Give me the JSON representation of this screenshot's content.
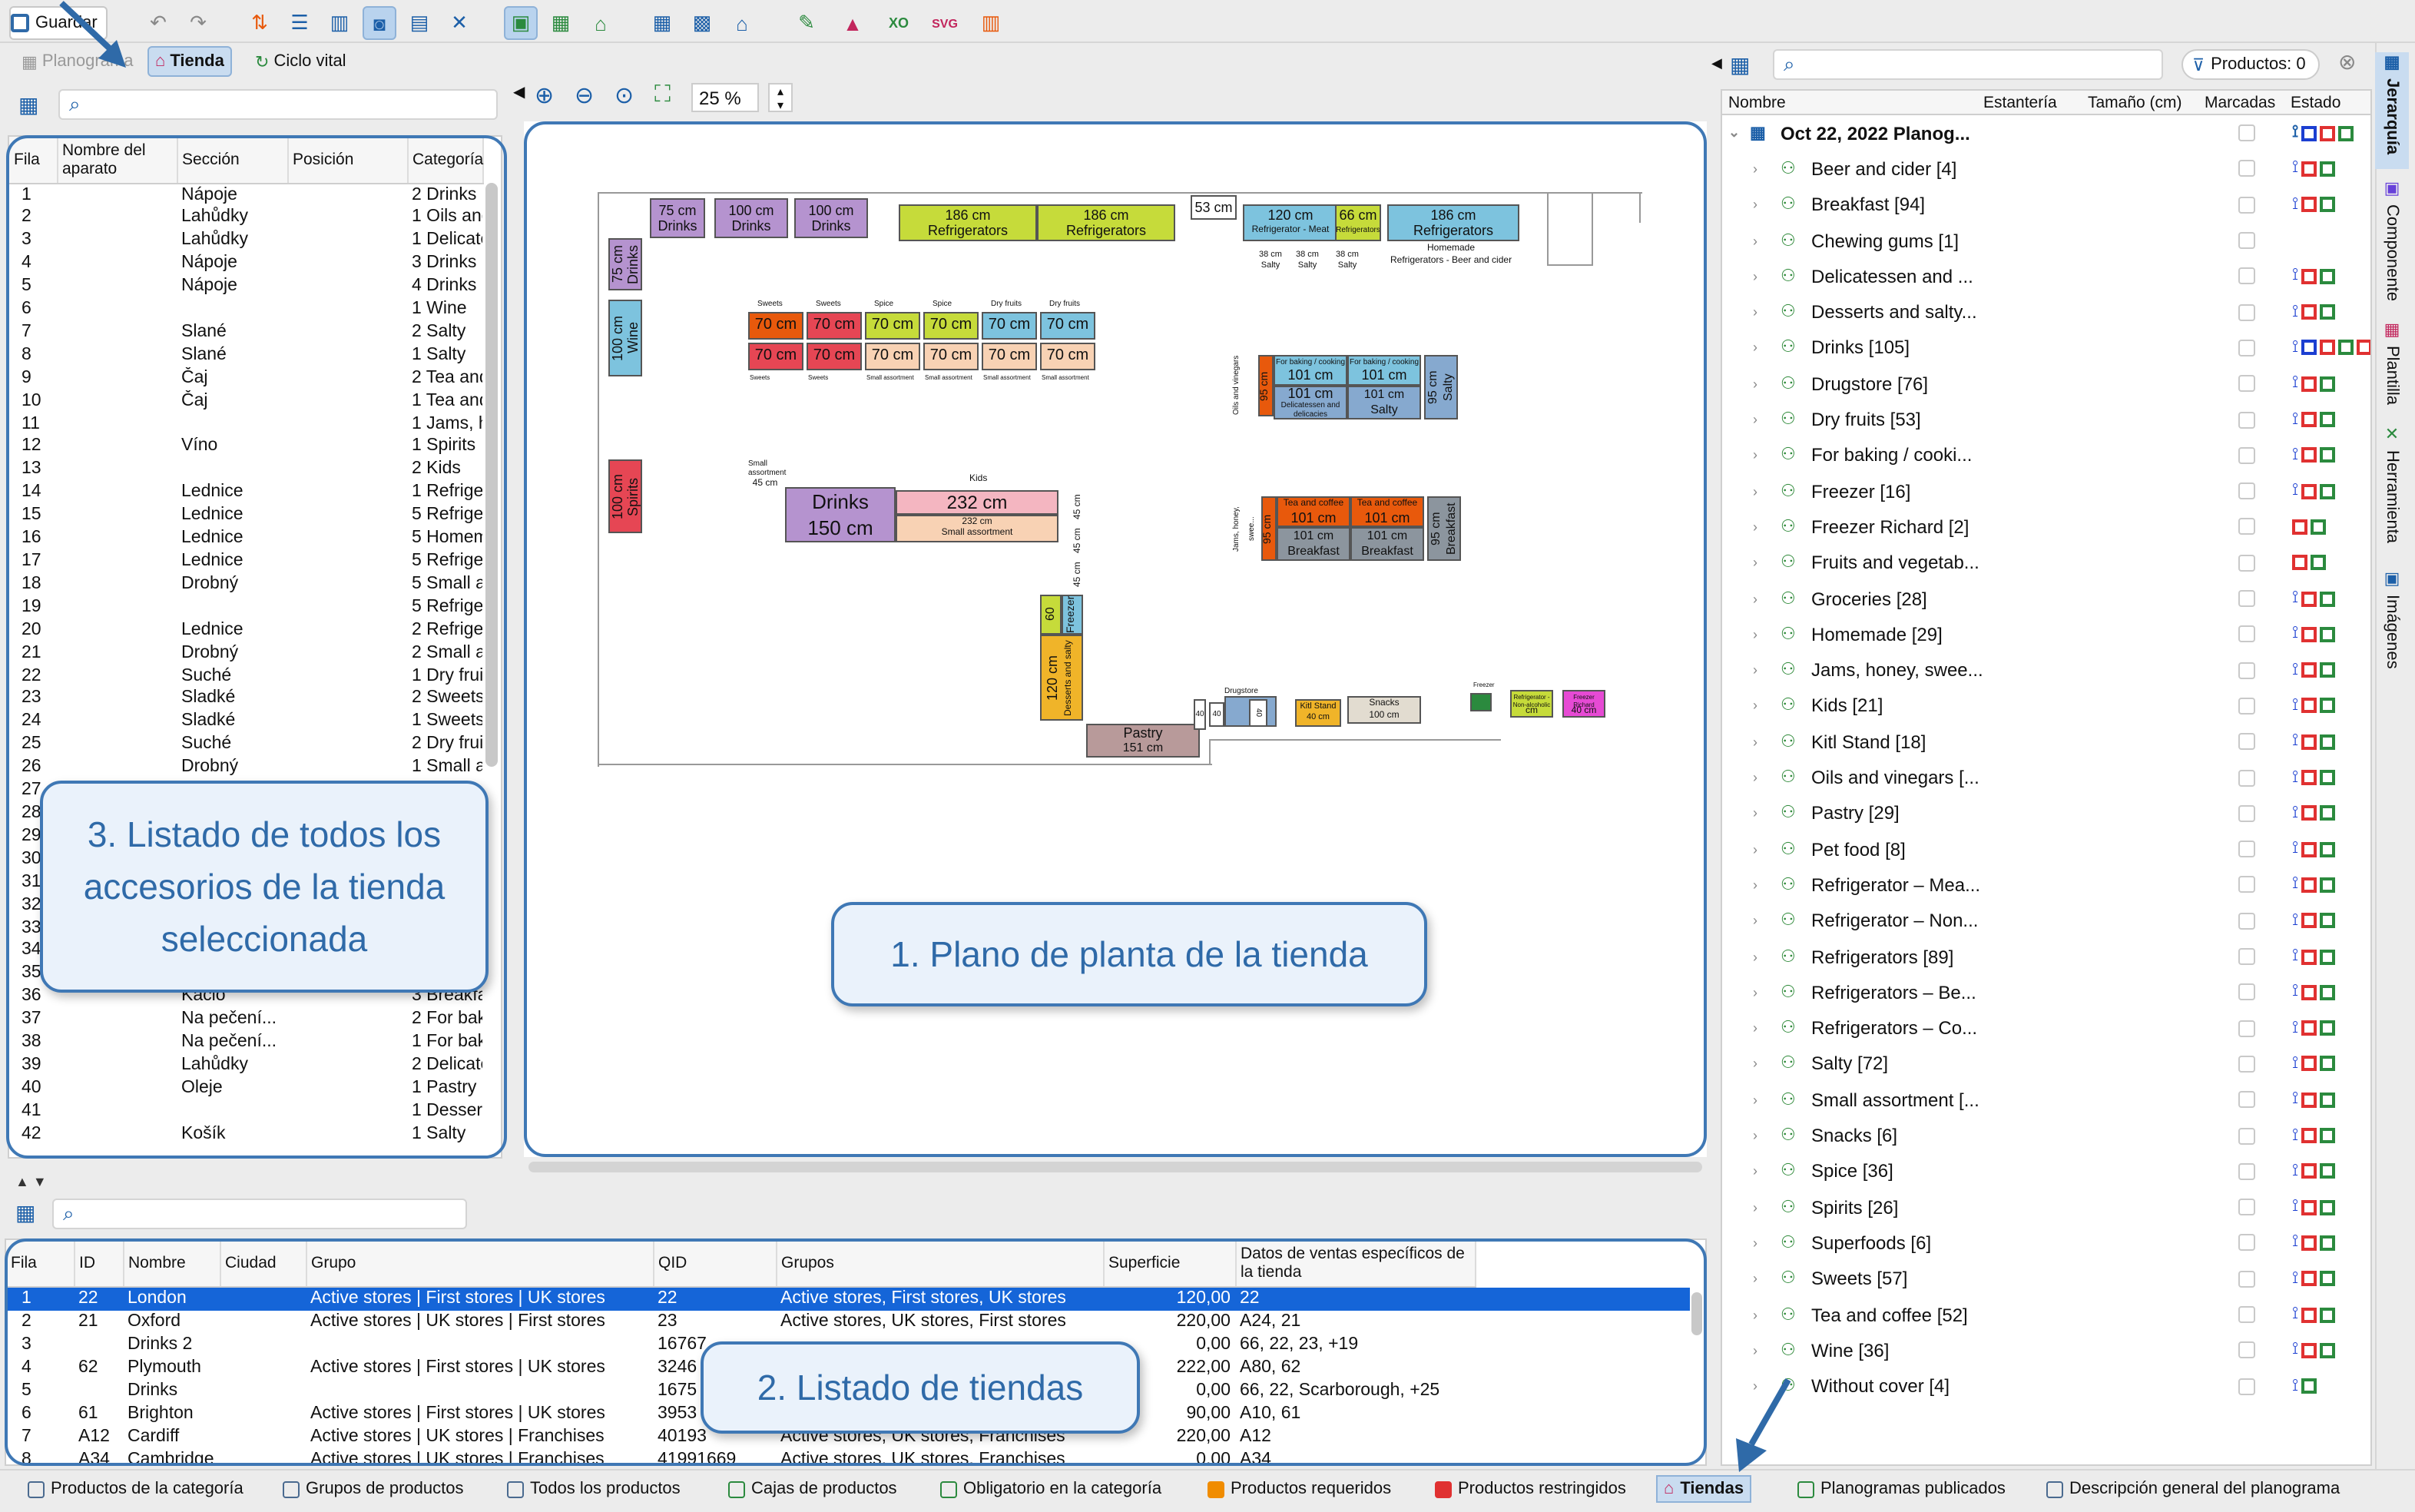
{
  "toolbar": {
    "save_label": "Guardar"
  },
  "view_tabs": [
    {
      "label": "Planograma",
      "active": false
    },
    {
      "label": "Tienda",
      "active": true
    },
    {
      "label": "Ciclo vital",
      "active": false
    }
  ],
  "zoom": {
    "value": "25 %"
  },
  "fixture_table": {
    "headers": [
      "Fila",
      "Nombre del aparato",
      "Sección",
      "Posición",
      "Categoría"
    ],
    "rows": [
      [
        "1",
        "",
        "Nápoje",
        "",
        "2 Drinks"
      ],
      [
        "2",
        "",
        "Lahůdky",
        "",
        "1 Oils and"
      ],
      [
        "3",
        "",
        "Lahůdky",
        "",
        "1 Delicates"
      ],
      [
        "4",
        "",
        "Nápoje",
        "",
        "3 Drinks"
      ],
      [
        "5",
        "",
        "Nápoje",
        "",
        "4 Drinks"
      ],
      [
        "6",
        "",
        "",
        "",
        "1 Wine"
      ],
      [
        "7",
        "",
        "Slané",
        "",
        "2 Salty"
      ],
      [
        "8",
        "",
        "Slané",
        "",
        "1 Salty"
      ],
      [
        "9",
        "",
        "Čaj",
        "",
        "2 Tea and"
      ],
      [
        "10",
        "",
        "Čaj",
        "",
        "1 Tea and"
      ],
      [
        "11",
        "",
        "",
        "",
        "1 Jams, ho"
      ],
      [
        "12",
        "",
        "Víno",
        "",
        "1 Spirits"
      ],
      [
        "13",
        "",
        "",
        "",
        "2 Kids"
      ],
      [
        "14",
        "",
        "Lednice",
        "",
        "1 Refrigera"
      ],
      [
        "15",
        "",
        "Lednice",
        "",
        "5 Refrigera"
      ],
      [
        "16",
        "",
        "Lednice",
        "",
        "5 Homema"
      ],
      [
        "17",
        "",
        "Lednice",
        "",
        "5 Refrigera"
      ],
      [
        "18",
        "",
        "Drobný",
        "",
        "5 Small as"
      ],
      [
        "19",
        "",
        "",
        "",
        "5 Refrigera"
      ],
      [
        "20",
        "",
        "Lednice",
        "",
        "2 Refrigera"
      ],
      [
        "21",
        "",
        "Drobný",
        "",
        "2 Small as"
      ],
      [
        "22",
        "",
        "Suché",
        "",
        "1 Dry fruit"
      ],
      [
        "23",
        "",
        "Sladké",
        "",
        "2 Sweets"
      ],
      [
        "24",
        "",
        "Sladké",
        "",
        "1 Sweets"
      ],
      [
        "25",
        "",
        "Suché",
        "",
        "2 Dry fruit"
      ],
      [
        "26",
        "",
        "Drobný",
        "",
        "1 Small as"
      ],
      [
        "27",
        "",
        "",
        "",
        ""
      ],
      [
        "28",
        "",
        "",
        "",
        ""
      ],
      [
        "29",
        "",
        "",
        "",
        ""
      ],
      [
        "30",
        "",
        "",
        "",
        ""
      ],
      [
        "31",
        "",
        "",
        "",
        ""
      ],
      [
        "32",
        "",
        "",
        "",
        ""
      ],
      [
        "33",
        "",
        "",
        "",
        ""
      ],
      [
        "34",
        "",
        "",
        "",
        ""
      ],
      [
        "35",
        "",
        "",
        "",
        ""
      ],
      [
        "36",
        "",
        "Kačio",
        "",
        "3 Breakfas"
      ],
      [
        "37",
        "",
        "Na pečení...",
        "",
        "2 For baki"
      ],
      [
        "38",
        "",
        "Na pečení...",
        "",
        "1 For baki"
      ],
      [
        "39",
        "",
        "Lahůdky",
        "",
        "2 Delicates"
      ],
      [
        "40",
        "",
        "Oleje",
        "",
        "1 Pastry"
      ],
      [
        "41",
        "",
        "",
        "",
        "1 Desserts"
      ],
      [
        "42",
        "",
        "Košík",
        "",
        "1 Salty"
      ]
    ]
  },
  "stores_table": {
    "headers": [
      "Fila",
      "ID",
      "Nombre",
      "Ciudad",
      "Grupo",
      "QID",
      "Grupos",
      "Superficie",
      "Datos de ventas específicos de la tienda"
    ],
    "rows": [
      [
        "1",
        "22",
        "London",
        "",
        "Active stores | First stores | UK stores",
        "22",
        "Active stores, First stores, UK stores",
        "120,00",
        "22"
      ],
      [
        "2",
        "21",
        "Oxford",
        "",
        "Active stores | UK stores | First stores",
        "23",
        "Active stores, UK stores, First stores",
        "220,00",
        "A24, 21"
      ],
      [
        "3",
        "",
        "Drinks 2",
        "",
        "",
        "16767",
        "",
        "0,00",
        "66, 22, 23, +19"
      ],
      [
        "4",
        "62",
        "Plymouth",
        "",
        "Active stores | First stores | UK stores",
        "3246",
        "",
        "222,00",
        "A80, 62"
      ],
      [
        "5",
        "",
        "Drinks",
        "",
        "",
        "1675",
        "",
        "0,00",
        "66, 22, Scarborough, +25"
      ],
      [
        "6",
        "61",
        "Brighton",
        "",
        "Active stores | First stores | UK stores",
        "3953",
        "",
        "90,00",
        "A10, 61"
      ],
      [
        "7",
        "A12",
        "Cardiff",
        "",
        "Active stores | UK stores | Franchises",
        "40193",
        "Active stores, UK stores, Franchises",
        "220,00",
        "A12"
      ],
      [
        "8",
        "A34",
        "Cambridge",
        "",
        "Active stores | UK stores | Franchises",
        "41991669",
        "Active stores, UK stores, Franchises",
        "0,00",
        "A34"
      ]
    ]
  },
  "products_header": {
    "label": "Productos: 0"
  },
  "hierarchy_headers": [
    "Nombre",
    "Estantería",
    "Tamaño (cm)",
    "Marcadas",
    "Estado"
  ],
  "hierarchy_root": "Oct 22, 2022 Planog...",
  "hierarchy": [
    {
      "name": "Beer and cider [4]",
      "s": "rg"
    },
    {
      "name": "Breakfast [94]",
      "s": "rg"
    },
    {
      "name": "Chewing gums [1]",
      "s": ""
    },
    {
      "name": "Delicatessen and ...",
      "s": "rg"
    },
    {
      "name": "Desserts and salty...",
      "s": "rg"
    },
    {
      "name": "Drinks [105]",
      "s": "brgr"
    },
    {
      "name": "Drugstore [76]",
      "s": "rg"
    },
    {
      "name": "Dry fruits [53]",
      "s": "rg"
    },
    {
      "name": "For baking / cooki...",
      "s": "rg"
    },
    {
      "name": "Freezer [16]",
      "s": "rg"
    },
    {
      "name": "Freezer Richard [2]",
      "s": "rgn"
    },
    {
      "name": "Fruits and vegetab...",
      "s": "rgn"
    },
    {
      "name": "Groceries [28]",
      "s": "rg"
    },
    {
      "name": "Homemade [29]",
      "s": "rg"
    },
    {
      "name": "Jams, honey, swee...",
      "s": "rg"
    },
    {
      "name": "Kids [21]",
      "s": "rg"
    },
    {
      "name": "Kitl Stand [18]",
      "s": "rg"
    },
    {
      "name": "Oils and vinegars [...",
      "s": "rg"
    },
    {
      "name": "Pastry [29]",
      "s": "rg"
    },
    {
      "name": "Pet food [8]",
      "s": "rg"
    },
    {
      "name": "Refrigerator – Mea...",
      "s": "rg"
    },
    {
      "name": "Refrigerator – Non...",
      "s": "rg"
    },
    {
      "name": "Refrigerators [89]",
      "s": "rg"
    },
    {
      "name": "Refrigerators – Be...",
      "s": "rg"
    },
    {
      "name": "Refrigerators – Co...",
      "s": "rg"
    },
    {
      "name": "Salty [72]",
      "s": "rg"
    },
    {
      "name": "Small assortment [...",
      "s": "rg"
    },
    {
      "name": "Snacks [6]",
      "s": "rg"
    },
    {
      "name": "Spice [36]",
      "s": "rg"
    },
    {
      "name": "Spirits [26]",
      "s": "rg"
    },
    {
      "name": "Superfoods [6]",
      "s": "rg"
    },
    {
      "name": "Sweets [57]",
      "s": "rg"
    },
    {
      "name": "Tea and coffee [52]",
      "s": "rg"
    },
    {
      "name": "Wine [36]",
      "s": "rg"
    },
    {
      "name": "Without cover [4]",
      "s": "g"
    }
  ],
  "side_tabs": [
    "Jerarquía",
    "Componente",
    "Plantilla",
    "Herramienta",
    "Imágenes"
  ],
  "bottom_tabs": [
    "Productos de la categoría",
    "Grupos de productos",
    "Todos los productos",
    "Cajas de productos",
    "Obligatorio en la categoría",
    "Productos requeridos",
    "Productos restringidos",
    "Tiendas",
    "Planogramas publicados",
    "Descripción general del planograma"
  ],
  "callouts": {
    "c1": "1. Plano de planta de la tienda",
    "c2": "2. Listado de tiendas",
    "c3": "3. Listado de todos los accesorios de la tienda seleccionada"
  },
  "floor": {
    "f1": [
      "75 cm",
      "Drinks"
    ],
    "f2": [
      "100 cm",
      "Drinks"
    ],
    "f3": [
      "100 cm",
      "Drinks"
    ],
    "f4": [
      "186 cm",
      "Refrigerators"
    ],
    "f5": [
      "186 cm",
      "Refrigerators"
    ],
    "f6": "53 cm",
    "f7": [
      "120 cm",
      "Refrigerator - Meat"
    ],
    "f8": [
      "66 cm",
      "Refrigerators"
    ],
    "f9": [
      "186 cm",
      "Refrigerators"
    ],
    "f9b": "Homemade",
    "f9c": "Refrigerators - Beer and cider",
    "sm1": [
      "38 cm",
      "Salty"
    ],
    "sm2": [
      "38 cm",
      "Salty"
    ],
    "sm3": [
      "38 cm",
      "Salty"
    ],
    "v1": [
      "75 cm",
      "Drinks"
    ],
    "v2": [
      "100 cm",
      "Wine"
    ],
    "v3": [
      "100 cm",
      "Spirits"
    ],
    "sw": [
      "Sweets",
      "Sweets",
      "Spice",
      "Spice",
      "Dry fruits",
      "Dry fruits"
    ],
    "c70": "70 cm",
    "swb": [
      "Sweets",
      "Sweets",
      "Small assortment",
      "Small assortment",
      "Small assortment",
      "Small assortment"
    ],
    "bk": [
      "For baking / cooking",
      "For baking / cooking",
      "Delicatessen and delicacies",
      "Salty",
      "Oils and vinegars",
      "95 cm",
      "101 cm"
    ],
    "tc": [
      "Tea and coffee",
      "Tea and coffee",
      "Breakfast",
      "Breakfast",
      "Jams, honey, swee..."
    ],
    "drinks150": [
      "Drinks",
      "150 cm"
    ],
    "kids": [
      "Kids",
      "232 cm",
      "232 cm",
      "Small assortment"
    ],
    "c45": "45 cm",
    "small45": "45 cm",
    "v120": [
      "120 cm",
      "Desserts and salty"
    ],
    "v60": [
      "60",
      "Freezer"
    ],
    "pastry": [
      "Pastry",
      "151 cm"
    ],
    "drug": "Drugstore",
    "c40": "40",
    "kitl": [
      "Kitl Stand",
      "40 cm"
    ],
    "snacks": [
      "Snacks",
      "100 cm"
    ],
    "fr": "Freezer",
    "rn": [
      "Refrigerator - Non-alcoholic",
      "cm"
    ],
    "frr": [
      "Freezer Richard",
      "40 cm"
    ],
    "sa": "Small assortment"
  }
}
